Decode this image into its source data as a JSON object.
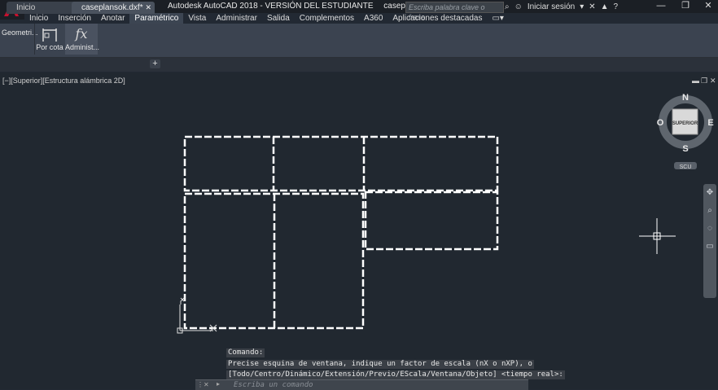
{
  "app": {
    "title": "Autodesk AutoCAD 2018 - VERSIÓN DEL ESTUDIANTE",
    "file": "caseplansok.dxf",
    "search_placeholder": "Escriba palabra clave o frase",
    "signin_label": "Iniciar sesión"
  },
  "menu": {
    "tabs": [
      "Inicio",
      "Inserción",
      "Anotar",
      "Paramétrico",
      "Vista",
      "Administrar",
      "Salida",
      "Complementos",
      "A360",
      "Aplicaciones destacadas"
    ],
    "active": "Paramétrico"
  },
  "ribbon": {
    "geometric_label": "Geometri...",
    "dimensional_label": "Por cota",
    "manage_label": "Administ..."
  },
  "doc_tabs": {
    "start": "Inicio",
    "current": "caseplansok.dxf*"
  },
  "viewport": {
    "label": "[−][Superior][Estructura alámbrica 2D]",
    "viewcube_face": "SUPERIOR",
    "compass": {
      "n": "N",
      "s": "S",
      "e": "E",
      "w": "O"
    },
    "ucs_label": "SCU"
  },
  "command": {
    "history": [
      "Comando:",
      "Precise esquina de ventana, indique un factor de escala (nX o nXP), o",
      "[Todo/Centro/Dinámico/Extensión/Previo/EScala/Ventana/Objeto] <tiempo real>:"
    ],
    "placeholder": "Escriba un comando"
  },
  "colors": {
    "background": "#212830",
    "ribbon": "#3b4350",
    "accent_logo": "#c8102e",
    "lines": "#ffffff"
  }
}
